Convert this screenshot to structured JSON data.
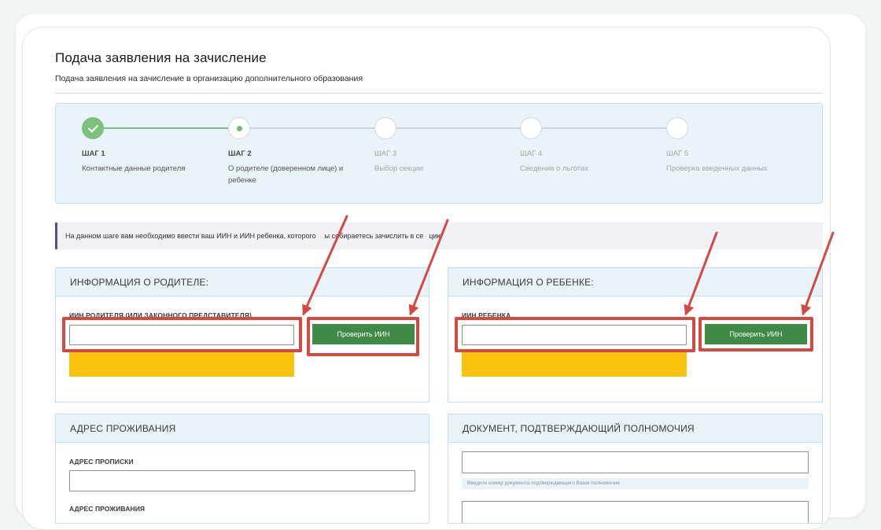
{
  "page": {
    "title": "Подача заявления на зачисление",
    "subtitle": "Подача заявления на зачисление в организацию дополнительного образования"
  },
  "steps": [
    {
      "num": "ШАГ 1",
      "label": "Контактные данные родителя",
      "state": "done"
    },
    {
      "num": "ШАГ 2",
      "label_line1": "О родителе (доверенном лице) и",
      "label_line2": "ребенке",
      "state": "active"
    },
    {
      "num": "ШАГ 3",
      "label": "Выбор секции",
      "state": "pending"
    },
    {
      "num": "ШАГ 4",
      "label": "Сведения о льготах",
      "state": "pending"
    },
    {
      "num": "ШАГ 5",
      "label": "Проверка введенных данных",
      "state": "pending"
    }
  ],
  "notice": {
    "text_part1": "На данном шаге вам необходимо ввести ваш ИИН и ИИН ребенка, которого",
    "text_part2": "ы собираетесь зачислить в се",
    "text_part3": "цию"
  },
  "parent_panel": {
    "title": "ИНФОРМАЦИЯ О РОДИТЕЛЕ:",
    "field_label": "ИИН РОДИТЕЛЯ (ИЛИ ЗАКОННОГО ПРЕДСТАВИТЕЛЯ)",
    "value": "",
    "button": "Проверить ИИН"
  },
  "child_panel": {
    "title": "ИНФОРМАЦИЯ О РЕБЕНКЕ:",
    "field_label": "ИИН РЕБЕНКА",
    "value": "",
    "button": "Проверить ИИН"
  },
  "address_panel": {
    "title": "АДРЕС ПРОЖИВАНИЯ",
    "registration_label": "АДРЕС ПРОПИСКИ",
    "registration_value": "",
    "residence_label": "АДРЕС ПРОЖИВАНИЯ"
  },
  "document_panel": {
    "title": "ДОКУМЕНТ, ПОДТВЕРЖДАЮЩИЙ ПОЛНОМОЧИЯ",
    "value": "",
    "hint": "Введите номер документа подтверждающего Ваши полномочия"
  },
  "colors": {
    "accent_green": "#3e8a46",
    "step_done": "#7cc27e",
    "highlight_red": "#d24a42",
    "warning_yellow": "#f8c20f",
    "panel_blue": "#e8f3fa"
  }
}
